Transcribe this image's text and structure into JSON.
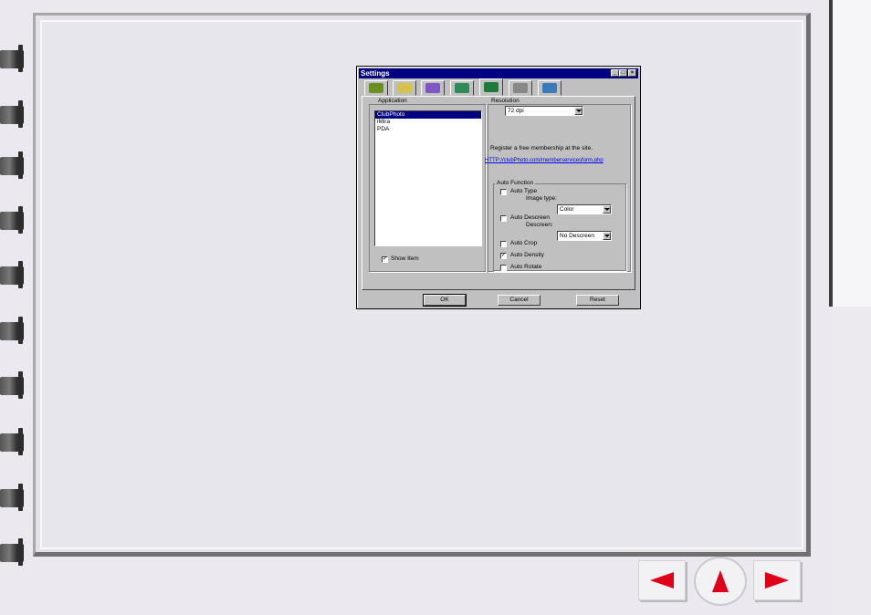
{
  "dialog": {
    "title": "Settings",
    "titlebar_buttons": {
      "minimize": "_",
      "maximize": "□",
      "close": "×"
    },
    "tabs": [
      {
        "icon": "gear-document-icon",
        "color": "#6b8e23"
      },
      {
        "icon": "folder-photo-icon",
        "color": "#d6c24a"
      },
      {
        "icon": "w-document-icon",
        "color": "#7e57c2"
      },
      {
        "icon": "globe-icon",
        "color": "#2e8b57"
      },
      {
        "icon": "network-gear-icon",
        "color": "#1f7a3a"
      },
      {
        "icon": "gear-pair-icon",
        "color": "#888888"
      },
      {
        "icon": "scanner-icon",
        "color": "#3a7ab8"
      }
    ],
    "active_tab": 4,
    "application": {
      "label": "Application",
      "items": [
        "ClubPhoto",
        "iMira",
        "PDA"
      ],
      "selected": 0,
      "show_item_label": "Show Item",
      "show_item_checked": true
    },
    "resolution": {
      "label": "Resolution",
      "value": "72 dpi"
    },
    "register_text": "Register a free membership at the site.",
    "register_link": "HTTP://clubPhoto.com/memberservicesform.php",
    "auto_function": {
      "label": "Auto Function",
      "auto_type": {
        "label": "Auto Type",
        "checked": false
      },
      "image_type_label": "Image type:",
      "image_type_value": "Color",
      "auto_descreen": {
        "label": "Auto Descreen",
        "checked": false
      },
      "descreen_label": "Descreen:",
      "descreen_value": "No Descreen",
      "auto_crop": {
        "label": "Auto Crop",
        "checked": false
      },
      "auto_density": {
        "label": "Auto Density",
        "checked": true
      },
      "auto_rotate": {
        "label": "Auto Rotate",
        "checked": false
      }
    },
    "buttons": {
      "ok": "OK",
      "cancel": "Cancel",
      "reset": "Reset"
    }
  },
  "check_mark": "✓",
  "nav": {
    "prev": "previous-page-arrow-icon",
    "home": "up-arrow-icon",
    "next": "next-page-arrow-icon",
    "accent": "#e1001a"
  }
}
